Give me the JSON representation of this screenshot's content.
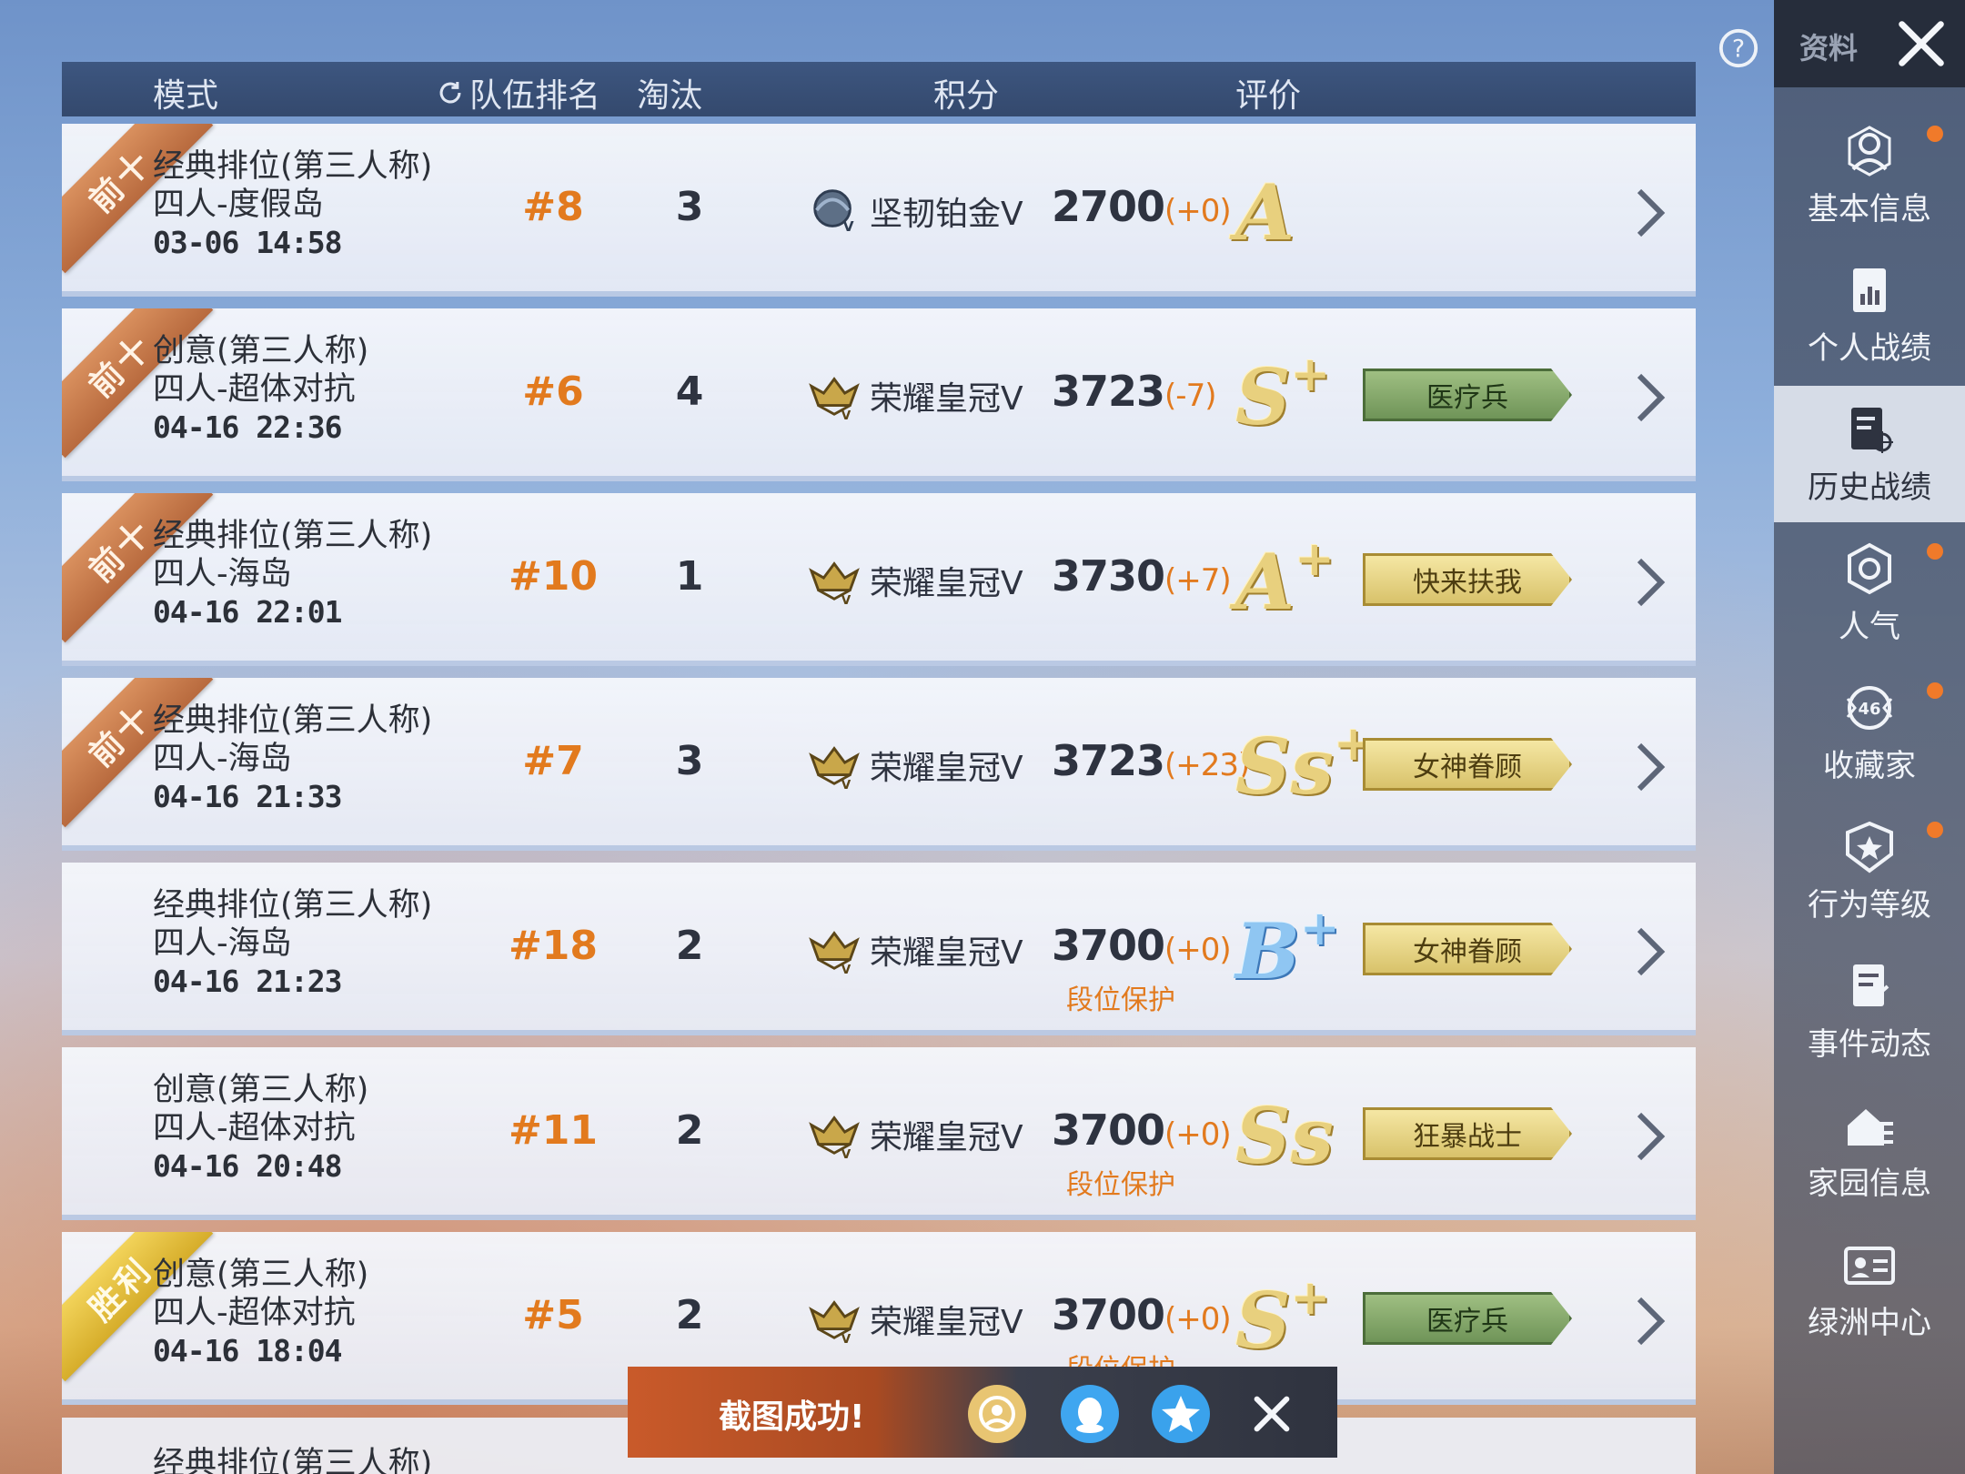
{
  "header": {
    "mode": "模式",
    "team_rank": "队伍排名",
    "eliminations": "淘汰",
    "score": "积分",
    "rating": "评价"
  },
  "rows": [
    {
      "ribbon": "前十",
      "ribbon_type": "top10",
      "mode": "经典排位(第三人称)",
      "map": "四人-度假岛",
      "time": "03-06 14:58",
      "rank": "#8",
      "kills": "3",
      "tier": "坚韧铂金Ⅴ",
      "tier_icon": "platinum-tier-icon",
      "score": "2700",
      "delta": "(+0)",
      "protect": "",
      "grade": "A",
      "grade_plus": "",
      "grade_color": "gold",
      "badge": "",
      "badge_type": ""
    },
    {
      "ribbon": "前十",
      "ribbon_type": "top10",
      "mode": "创意(第三人称)",
      "map": "四人-超体对抗",
      "time": "04-16 22:36",
      "rank": "#6",
      "kills": "4",
      "tier": "荣耀皇冠Ⅴ",
      "tier_icon": "crown-tier-icon",
      "score": "3723",
      "delta": "(-7)",
      "protect": "",
      "grade": "S",
      "grade_plus": "+",
      "grade_color": "gold",
      "badge": "医疗兵",
      "badge_type": "green"
    },
    {
      "ribbon": "前十",
      "ribbon_type": "top10",
      "mode": "经典排位(第三人称)",
      "map": "四人-海岛",
      "time": "04-16 22:01",
      "rank": "#10",
      "kills": "1",
      "tier": "荣耀皇冠Ⅴ",
      "tier_icon": "crown-tier-icon",
      "score": "3730",
      "delta": "(+7)",
      "protect": "",
      "grade": "A",
      "grade_plus": "+",
      "grade_color": "gold",
      "badge": "快来扶我",
      "badge_type": "gold"
    },
    {
      "ribbon": "前十",
      "ribbon_type": "top10",
      "mode": "经典排位(第三人称)",
      "map": "四人-海岛",
      "time": "04-16 21:33",
      "rank": "#7",
      "kills": "3",
      "tier": "荣耀皇冠Ⅴ",
      "tier_icon": "crown-tier-icon",
      "score": "3723",
      "delta": "(+23)",
      "protect": "",
      "grade": "Ss",
      "grade_plus": "+",
      "grade_color": "gold",
      "badge": "女神眷顾",
      "badge_type": "gold"
    },
    {
      "ribbon": "",
      "ribbon_type": "",
      "mode": "经典排位(第三人称)",
      "map": "四人-海岛",
      "time": "04-16 21:23",
      "rank": "#18",
      "kills": "2",
      "tier": "荣耀皇冠Ⅴ",
      "tier_icon": "crown-tier-icon",
      "score": "3700",
      "delta": "(+0)",
      "protect": "段位保护",
      "grade": "B",
      "grade_plus": "+",
      "grade_color": "blue",
      "badge": "女神眷顾",
      "badge_type": "gold"
    },
    {
      "ribbon": "",
      "ribbon_type": "",
      "mode": "创意(第三人称)",
      "map": "四人-超体对抗",
      "time": "04-16 20:48",
      "rank": "#11",
      "kills": "2",
      "tier": "荣耀皇冠Ⅴ",
      "tier_icon": "crown-tier-icon",
      "score": "3700",
      "delta": "(+0)",
      "protect": "段位保护",
      "grade": "Ss",
      "grade_plus": "",
      "grade_color": "gold",
      "badge": "狂暴战士",
      "badge_type": "gold"
    },
    {
      "ribbon": "胜利",
      "ribbon_type": "win",
      "mode": "创意(第三人称)",
      "map": "四人-超体对抗",
      "time": "04-16 18:04",
      "rank": "#5",
      "kills": "2",
      "tier": "荣耀皇冠Ⅴ",
      "tier_icon": "crown-tier-icon",
      "score": "3700",
      "delta": "(+0)",
      "protect": "段位保护",
      "grade": "S",
      "grade_plus": "+",
      "grade_color": "gold",
      "badge": "医疗兵",
      "badge_type": "green"
    }
  ],
  "next_row_peek": "经典排位(第三人称)",
  "sidebar": {
    "title": "资料",
    "items": [
      {
        "label": "基本信息",
        "icon": "profile-icon",
        "dot": true
      },
      {
        "label": "个人战绩",
        "icon": "stats-chart-icon",
        "dot": false
      },
      {
        "label": "历史战绩",
        "icon": "history-icon",
        "dot": false,
        "active": true
      },
      {
        "label": "人气",
        "icon": "popularity-icon",
        "dot": true
      },
      {
        "label": "收藏家",
        "icon": "collector-icon",
        "dot": true,
        "level": "46"
      },
      {
        "label": "行为等级",
        "icon": "behavior-shield-icon",
        "dot": true
      },
      {
        "label": "事件动态",
        "icon": "event-doc-icon",
        "dot": false
      },
      {
        "label": "家园信息",
        "icon": "home-icon",
        "dot": false
      },
      {
        "label": "绿洲中心",
        "icon": "oasis-card-icon",
        "dot": false
      }
    ]
  },
  "toast": {
    "message": "截图成功!"
  },
  "colors": {
    "accent_orange": "#e27a1e",
    "header_bg": "#3d5680",
    "sidebar_bg": "#464f64",
    "badge_gold": "#d8c26a",
    "badge_green": "#6f9458"
  }
}
